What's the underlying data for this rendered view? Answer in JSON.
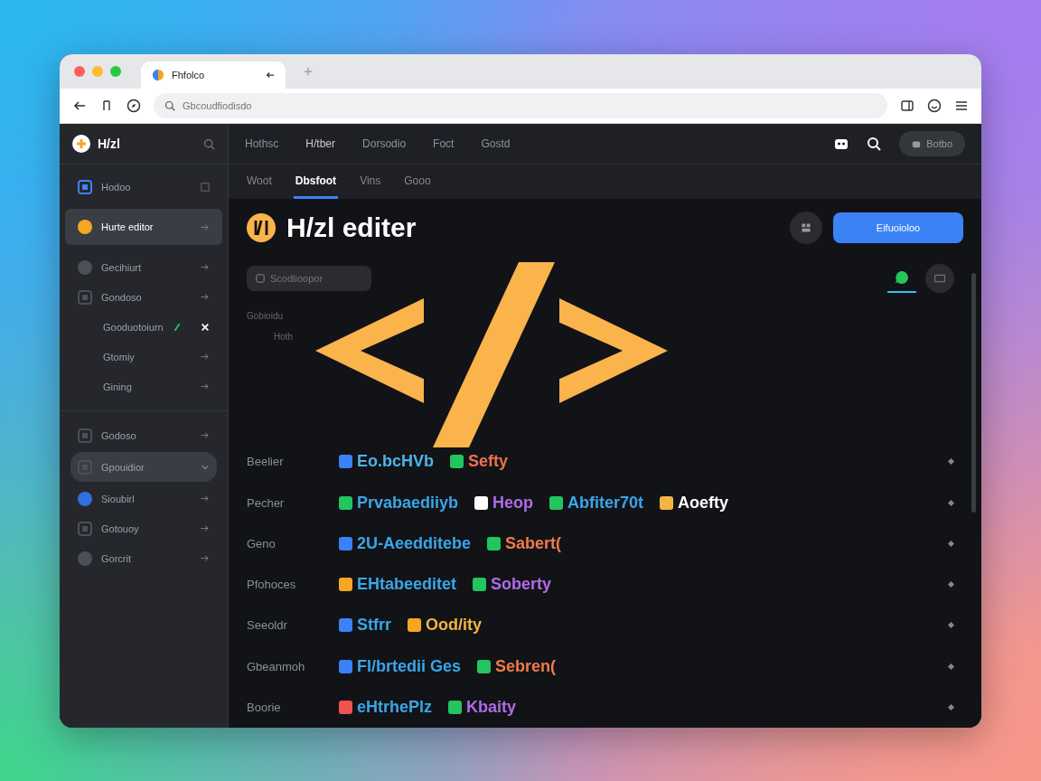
{
  "browser": {
    "tab_title": "Fhfolco",
    "address_placeholder": "Gbcoudfiodisdo"
  },
  "app": {
    "brand": "H/zl",
    "nav": [
      "Hothsc",
      "H/tber",
      "Dorsodio",
      "Foct",
      "Gostd"
    ],
    "nav_button": "Botbo"
  },
  "sidebar": {
    "top_item": {
      "label": "Hodoo",
      "color": "#3b82f6",
      "kind": "square"
    },
    "items": [
      {
        "label": "Hurte editor",
        "color": "#f5a623",
        "kind": "circle",
        "selected": true,
        "expanded": false
      },
      {
        "label": "Gecihiurt",
        "color": "#4b4f56",
        "kind": "circle",
        "selected": false,
        "expanded": false
      },
      {
        "label": "Gondoso",
        "color": "#4b4f56",
        "kind": "square",
        "selected": false,
        "expanded": false,
        "children": [
          {
            "label": "Gooduotoiurn",
            "editing": true
          },
          {
            "label": "Gtomiy",
            "editing": false
          },
          {
            "label": "Gining",
            "editing": false
          }
        ]
      }
    ],
    "items_2": [
      {
        "label": "Godoso",
        "color": "#4b4f56",
        "kind": "square",
        "selected": false,
        "expanded": false
      },
      {
        "label": "Gpouidior",
        "color": "#4b4f56",
        "kind": "square",
        "selected": false,
        "expanded": true
      },
      {
        "label": "Sioubirl",
        "color": "#2f6fe0",
        "kind": "circle",
        "selected": false,
        "expanded": false
      },
      {
        "label": "Gotouoy",
        "color": "#4b4f56",
        "kind": "square",
        "selected": false,
        "expanded": false
      },
      {
        "label": "Gorcrit",
        "color": "#4b4f56",
        "kind": "circle",
        "selected": false,
        "expanded": false
      }
    ]
  },
  "tabs": [
    {
      "label": "Woot",
      "selected": false
    },
    {
      "label": "Dbsfoot",
      "selected": true
    },
    {
      "label": "Vins",
      "selected": false
    },
    {
      "label": "Gooo",
      "selected": false
    }
  ],
  "main": {
    "title": "H/zl editer",
    "action_button": "Eifuoioloo",
    "search_placeholder": "Scodlioopor",
    "faint_lines": [
      "Gobioidu",
      "Hoth"
    ],
    "rows": [
      {
        "label": "Beelier",
        "tokens": [
          {
            "icon": {
              "color": "#3b82f6"
            },
            "word": {
              "text": "Eo.bcHVb",
              "color": "#4fb3e8"
            }
          },
          {
            "icon": {
              "color": "#22c55e"
            },
            "word": {
              "text": "Sefty",
              "color": "#f0714a"
            }
          }
        ]
      },
      {
        "label": "Pecher",
        "tokens": [
          {
            "icon": {
              "color": "#22c55e"
            },
            "word": {
              "text": "Prvabaediiyb",
              "color": "#3aa6e8"
            }
          },
          {
            "icon": {
              "color": "#ffffff"
            },
            "word": {
              "text": "Heop",
              "color": "#b06be8"
            }
          },
          {
            "icon": {
              "color": "#22c55e"
            },
            "word": {
              "text": "Abfiter70t",
              "color": "#3aa6e8"
            }
          },
          {
            "icon": {
              "color": "#f5b342"
            },
            "word": {
              "text": "Aoefty",
              "color": "#ffffff"
            }
          }
        ]
      },
      {
        "label": "Geno",
        "tokens": [
          {
            "icon": {
              "color": "#3b82f6"
            },
            "word": {
              "text": "2U-Aeedditebe",
              "color": "#3aa6e8"
            }
          },
          {
            "icon": {
              "color": "#22c55e"
            },
            "word": {
              "text": "Sabert(",
              "color": "#f07a4a"
            }
          }
        ]
      },
      {
        "label": "Pfohoces",
        "tokens": [
          {
            "icon": {
              "color": "#f5a623"
            },
            "word": {
              "text": "EHtabeeditet",
              "color": "#3aa6e8"
            }
          },
          {
            "icon": {
              "color": "#22c55e"
            },
            "word": {
              "text": "Soberty",
              "color": "#b06be8"
            }
          }
        ]
      },
      {
        "label": "Seeoldr",
        "tokens": [
          {
            "icon": {
              "color": "#3b82f6"
            },
            "word": {
              "text": "Stfrr",
              "color": "#3aa6e8"
            }
          },
          {
            "icon": {
              "color": "#f5a623"
            },
            "word": {
              "text": "Ood/ity",
              "color": "#f5b342"
            }
          }
        ]
      },
      {
        "label": "Gbeanmoh",
        "tokens": [
          {
            "icon": {
              "color": "#3b82f6"
            },
            "word": {
              "text": "Fl/brtedii Ges",
              "color": "#3aa6e8"
            }
          },
          {
            "icon": {
              "color": "#22c55e"
            },
            "word": {
              "text": "Sebren(",
              "color": "#f07a4a"
            }
          }
        ]
      },
      {
        "label": "Boorie",
        "tokens": [
          {
            "icon": {
              "color": "#ef5350"
            },
            "word": {
              "text": "eHtrhePlz",
              "color": "#3aa6e8"
            }
          },
          {
            "icon": {
              "color": "#22c55e"
            },
            "word": {
              "text": "Kbaity",
              "color": "#b06be8"
            }
          }
        ]
      }
    ]
  }
}
